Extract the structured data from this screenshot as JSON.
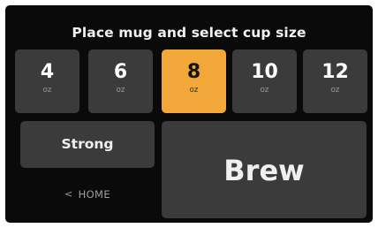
{
  "title": "Place mug and select cup size",
  "cup_sizes": [
    {
      "value": "4",
      "unit": "oz",
      "selected": false
    },
    {
      "value": "6",
      "unit": "oz",
      "selected": false
    },
    {
      "value": "8",
      "unit": "oz",
      "selected": true
    },
    {
      "value": "10",
      "unit": "oz",
      "selected": false
    },
    {
      "value": "12",
      "unit": "oz",
      "selected": false
    }
  ],
  "strength_label": "Strong",
  "brew_label": "Brew",
  "home": {
    "chevron": "<",
    "label": "HOME",
    "icon": "chevron-left-icon"
  },
  "colors": {
    "background": "#0a0a0a",
    "button": "#3b3b3b",
    "accent": "#f1a838",
    "text": "#f0f0f0",
    "muted_text": "#9e9e9e"
  }
}
